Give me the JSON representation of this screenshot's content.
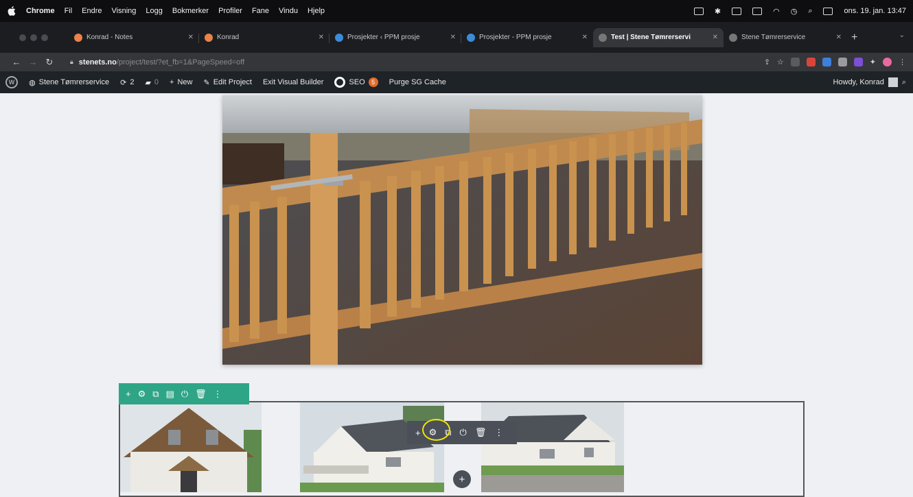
{
  "macos_menu": {
    "app": "Chrome",
    "items": [
      "Fil",
      "Endre",
      "Visning",
      "Logg",
      "Bokmerker",
      "Profiler",
      "Fane",
      "Vindu",
      "Hjelp"
    ],
    "clock": "ons. 19. jan. 13:47"
  },
  "tabs": [
    {
      "title": "Konrad - Notes",
      "favicon_color": "#e8834b"
    },
    {
      "title": "Konrad",
      "favicon_color": "#e8834b"
    },
    {
      "title": "Prosjekter ‹ PPM prosje",
      "favicon_color": "#3b8bd9"
    },
    {
      "title": "Prosjekter - PPM prosje",
      "favicon_color": "#3b8bd9"
    },
    {
      "title": "Test | Stene Tømrerservi",
      "favicon_color": "#888888"
    },
    {
      "title": "Stene Tømrerservice",
      "favicon_color": "#888888"
    }
  ],
  "active_tab": "Test | Stene Tømrerservi",
  "address": {
    "domain": "stenets.no",
    "path": "/project/test/?et_fb=1&PageSpeed=off"
  },
  "wp_admin_bar": {
    "site_name": "Stene Tømrerservice",
    "updates": "2",
    "comments": "0",
    "new_label": "New",
    "edit_label": "Edit Project",
    "exit_label": "Exit Visual Builder",
    "seo_label": "SEO",
    "seo_badge": "5",
    "purge_label": "Purge SG Cache",
    "howdy": "Howdy, Konrad"
  },
  "colors": {
    "row_toolbar": "#2ea586",
    "module_toolbar": "#4a4f58",
    "highlight_ring": "#f4e200",
    "wp_bar": "#1e2327"
  },
  "icons": {
    "row_toolbar": [
      "plus-icon",
      "gear-icon",
      "duplicate-icon",
      "columns-icon",
      "power-icon",
      "trash-icon",
      "more-icon"
    ],
    "module_toolbar": [
      "plus-icon",
      "gear-icon",
      "duplicate-icon",
      "power-icon",
      "trash-icon",
      "more-icon"
    ]
  }
}
